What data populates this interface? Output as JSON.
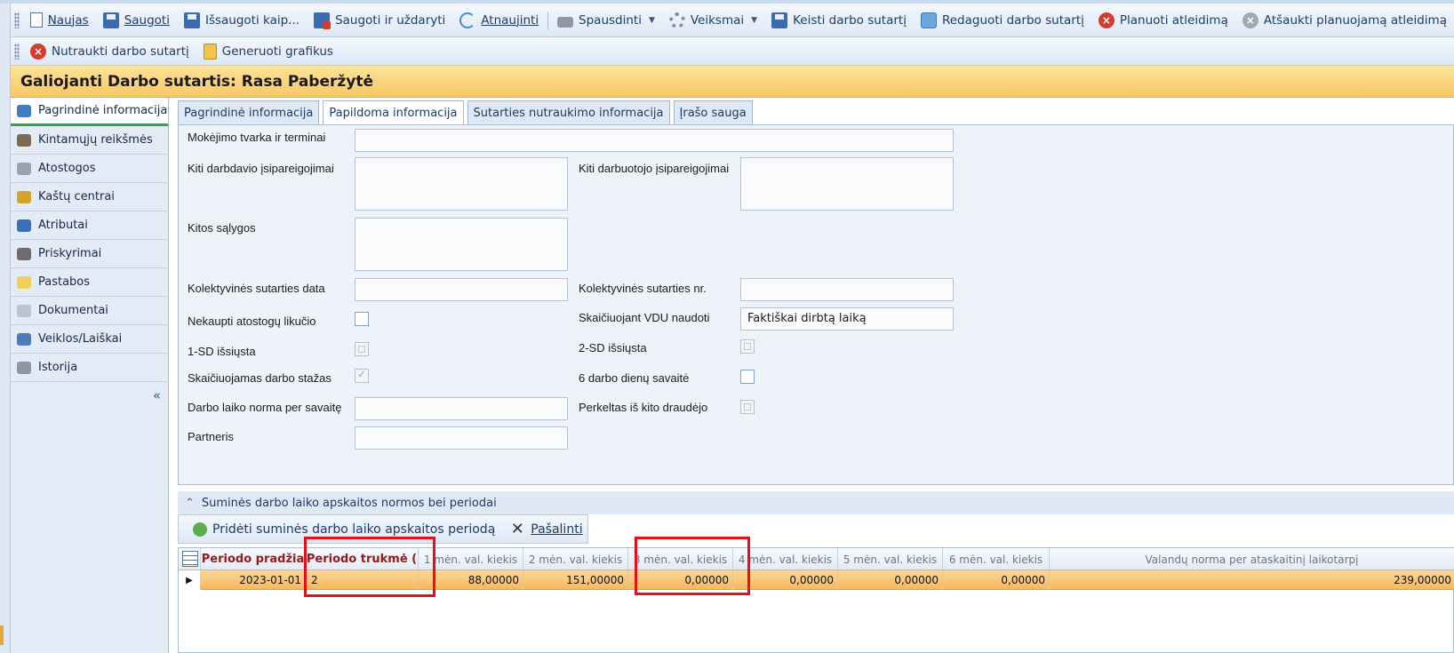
{
  "toolbar_main": [
    {
      "label": "Naujas",
      "icon": "new-document-icon"
    },
    {
      "label": "Saugoti",
      "icon": "save-icon"
    },
    {
      "label": "Išsaugoti kaip...",
      "icon": "save-as-icon"
    },
    {
      "label": "Saugoti ir uždaryti",
      "icon": "save-close-icon"
    },
    {
      "label": "Atnaujinti",
      "icon": "refresh-icon"
    },
    {
      "label": "Spausdinti",
      "icon": "printer-icon"
    },
    {
      "label": "Veiksmai",
      "icon": "gear-icon"
    },
    {
      "label": "Keisti darbo sutartį",
      "icon": "save-icon"
    },
    {
      "label": "Redaguoti darbo sutartį",
      "icon": "box-icon"
    },
    {
      "label": "Planuoti atleidimą",
      "icon": "cancel-red-icon"
    },
    {
      "label": "Atšaukti planuojamą atleidimą",
      "icon": "cancel-gray-icon"
    }
  ],
  "toolbar_secondary": [
    {
      "label": "Nutraukti darbo sutartį",
      "icon": "cancel-red-icon"
    },
    {
      "label": "Generuoti grafikus",
      "icon": "clipboard-icon"
    }
  ],
  "title": "Galiojanti Darbo sutartis: Rasa Paberžytė",
  "nav": {
    "items": [
      {
        "label": "Pagrindinė informacija",
        "color": "#3f7cc4"
      },
      {
        "label": "Kintamųjų reikšmės",
        "color": "#7d6b53"
      },
      {
        "label": "Atostogos",
        "color": "#9aa3ad"
      },
      {
        "label": "Kaštų centrai",
        "color": "#d5a22a"
      },
      {
        "label": "Atributai",
        "color": "#3b6fb9"
      },
      {
        "label": "Priskyrimai",
        "color": "#6d6d6d"
      },
      {
        "label": "Pastabos",
        "color": "#efcf5a"
      },
      {
        "label": "Dokumentai",
        "color": "#b9c4d1"
      },
      {
        "label": "Veiklos/Laiškai",
        "color": "#4f79b8"
      },
      {
        "label": "Istorija",
        "color": "#8d97a3"
      }
    ],
    "collapse": "«"
  },
  "tabs": [
    "Pagrindinė informacija",
    "Papildoma informacija",
    "Sutarties nutraukimo informacija",
    "Įrašo sauga"
  ],
  "form": {
    "payment_label": "Mokėjimo tvarka ir terminai",
    "employer_obligations_label": "Kiti darbdavio įsipareigojimai",
    "employee_obligations_label": "Kiti darbuotojo įsipareigojimai",
    "other_conditions_label": "Kitos sąlygos",
    "collective_date_label": "Kolektyvinės sutarties data",
    "collective_no_label": "Kolektyvinės sutarties nr.",
    "no_vacation_label": "Nekaupti atostogų likučio",
    "vdu_label": "Skaičiuojant VDU naudoti",
    "vdu_value": "Faktiškai dirbtą laiką",
    "sd1_label": "1-SD išsiųsta",
    "sd2_label": "2-SD išsiųsta",
    "seniority_label": "Skaičiuojamas darbo stažas",
    "six_day_label": "6 darbo dienų savaitė",
    "norm_label": "Darbo laiko norma per savaitę",
    "transferred_label": "Perkeltas iš kito draudėjo",
    "partner_label": "Partneris",
    "checks": {
      "no_vacation": false,
      "sd1": false,
      "sd2": false,
      "seniority": true,
      "six_day": false,
      "transferred": false
    }
  },
  "section": {
    "title": "Suminės darbo laiko apskaitos normos bei periodai",
    "add_label": "Pridėti suminės darbo laiko apskaitos periodą",
    "remove_label": "Pašalinti"
  },
  "grid": {
    "columns": [
      "Periodo pradžia",
      "Periodo trukmė (",
      "1 mėn. val. kiekis",
      "2 mėn. val. kiekis",
      "3 mėn. val. kiekis",
      "4 mėn. val. kiekis",
      "5 mėn. val. kiekis",
      "6 mėn. val. kiekis",
      "Valandų norma per ataskaitinį laikotarpį"
    ],
    "rows": [
      [
        "2023-01-01",
        "2",
        "88,00000",
        "151,00000",
        "0,00000",
        "0,00000",
        "0,00000",
        "0,00000",
        "239,00000"
      ]
    ],
    "row_indicator": "▶"
  }
}
